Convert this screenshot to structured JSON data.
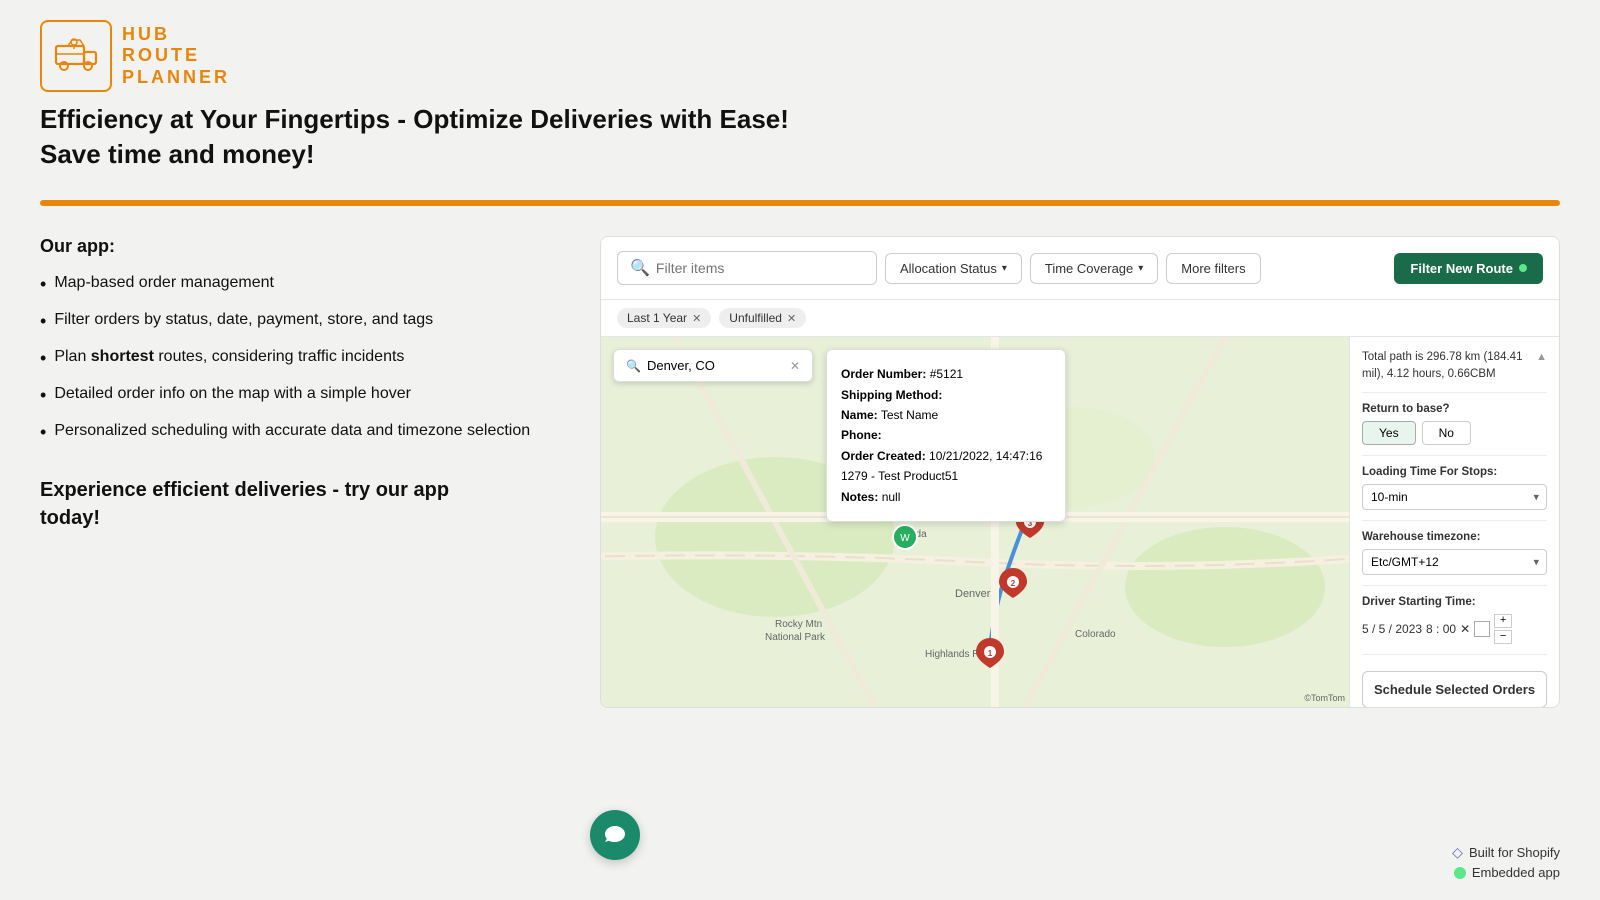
{
  "logo": {
    "lines": [
      "HUB",
      "ROUTE",
      "PLANNER"
    ]
  },
  "headline": {
    "line1": "Efficiency at Your Fingertips - Optimize Deliveries with Ease!",
    "line2": "Save time and money!"
  },
  "our_app_label": "Our app:",
  "features": [
    "Map-based order management",
    "Filter orders by status, date, payment, store, and tags",
    "Plan shortest routes, considering traffic incidents",
    "Detailed order info on the map with a simple hover",
    "Personalized scheduling with accurate data and timezone selection"
  ],
  "cta": {
    "line1": "Experience efficient deliveries - try our app",
    "line2": "today!"
  },
  "toolbar": {
    "search_placeholder": "Filter items",
    "allocation_status_label": "Allocation Status",
    "time_coverage_label": "Time Coverage",
    "more_filters_label": "More filters",
    "filter_new_route_label": "Filter New Route"
  },
  "tags": [
    {
      "label": "Last 1 Year"
    },
    {
      "label": "Unfulfilled"
    }
  ],
  "map_search": {
    "value": "Denver, CO"
  },
  "order_popup": {
    "order_number_label": "Order Number:",
    "order_number_value": "#5121",
    "shipping_method_label": "Shipping Method:",
    "shipping_method_value": "",
    "name_label": "Name:",
    "name_value": "Test Name",
    "phone_label": "Phone:",
    "phone_value": "",
    "order_created_label": "Order Created:",
    "order_created_value": "10/21/2022, 14:47:16",
    "product_line": "1279 - Test Product51",
    "notes_label": "Notes:",
    "notes_value": "null"
  },
  "right_panel": {
    "path_info": "Total path is 296.78 km (184.41 mil), 4.12 hours, 0.66CBM",
    "return_base_label": "Return to base?",
    "yes_label": "Yes",
    "no_label": "No",
    "loading_time_label": "Loading Time For Stops:",
    "loading_time_value": "10-min",
    "warehouse_tz_label": "Warehouse timezone:",
    "warehouse_tz_value": "Etc/GMT+12",
    "driver_start_label": "Driver Starting Time:",
    "driver_date": "5 / 5 / 2023",
    "driver_time": "8 : 00",
    "schedule_btn_label": "Schedule Selected Orders"
  },
  "footer": {
    "shopify_label": "Built for Shopify",
    "embedded_label": "Embedded app"
  },
  "tomtom_credit": "©TomTom"
}
